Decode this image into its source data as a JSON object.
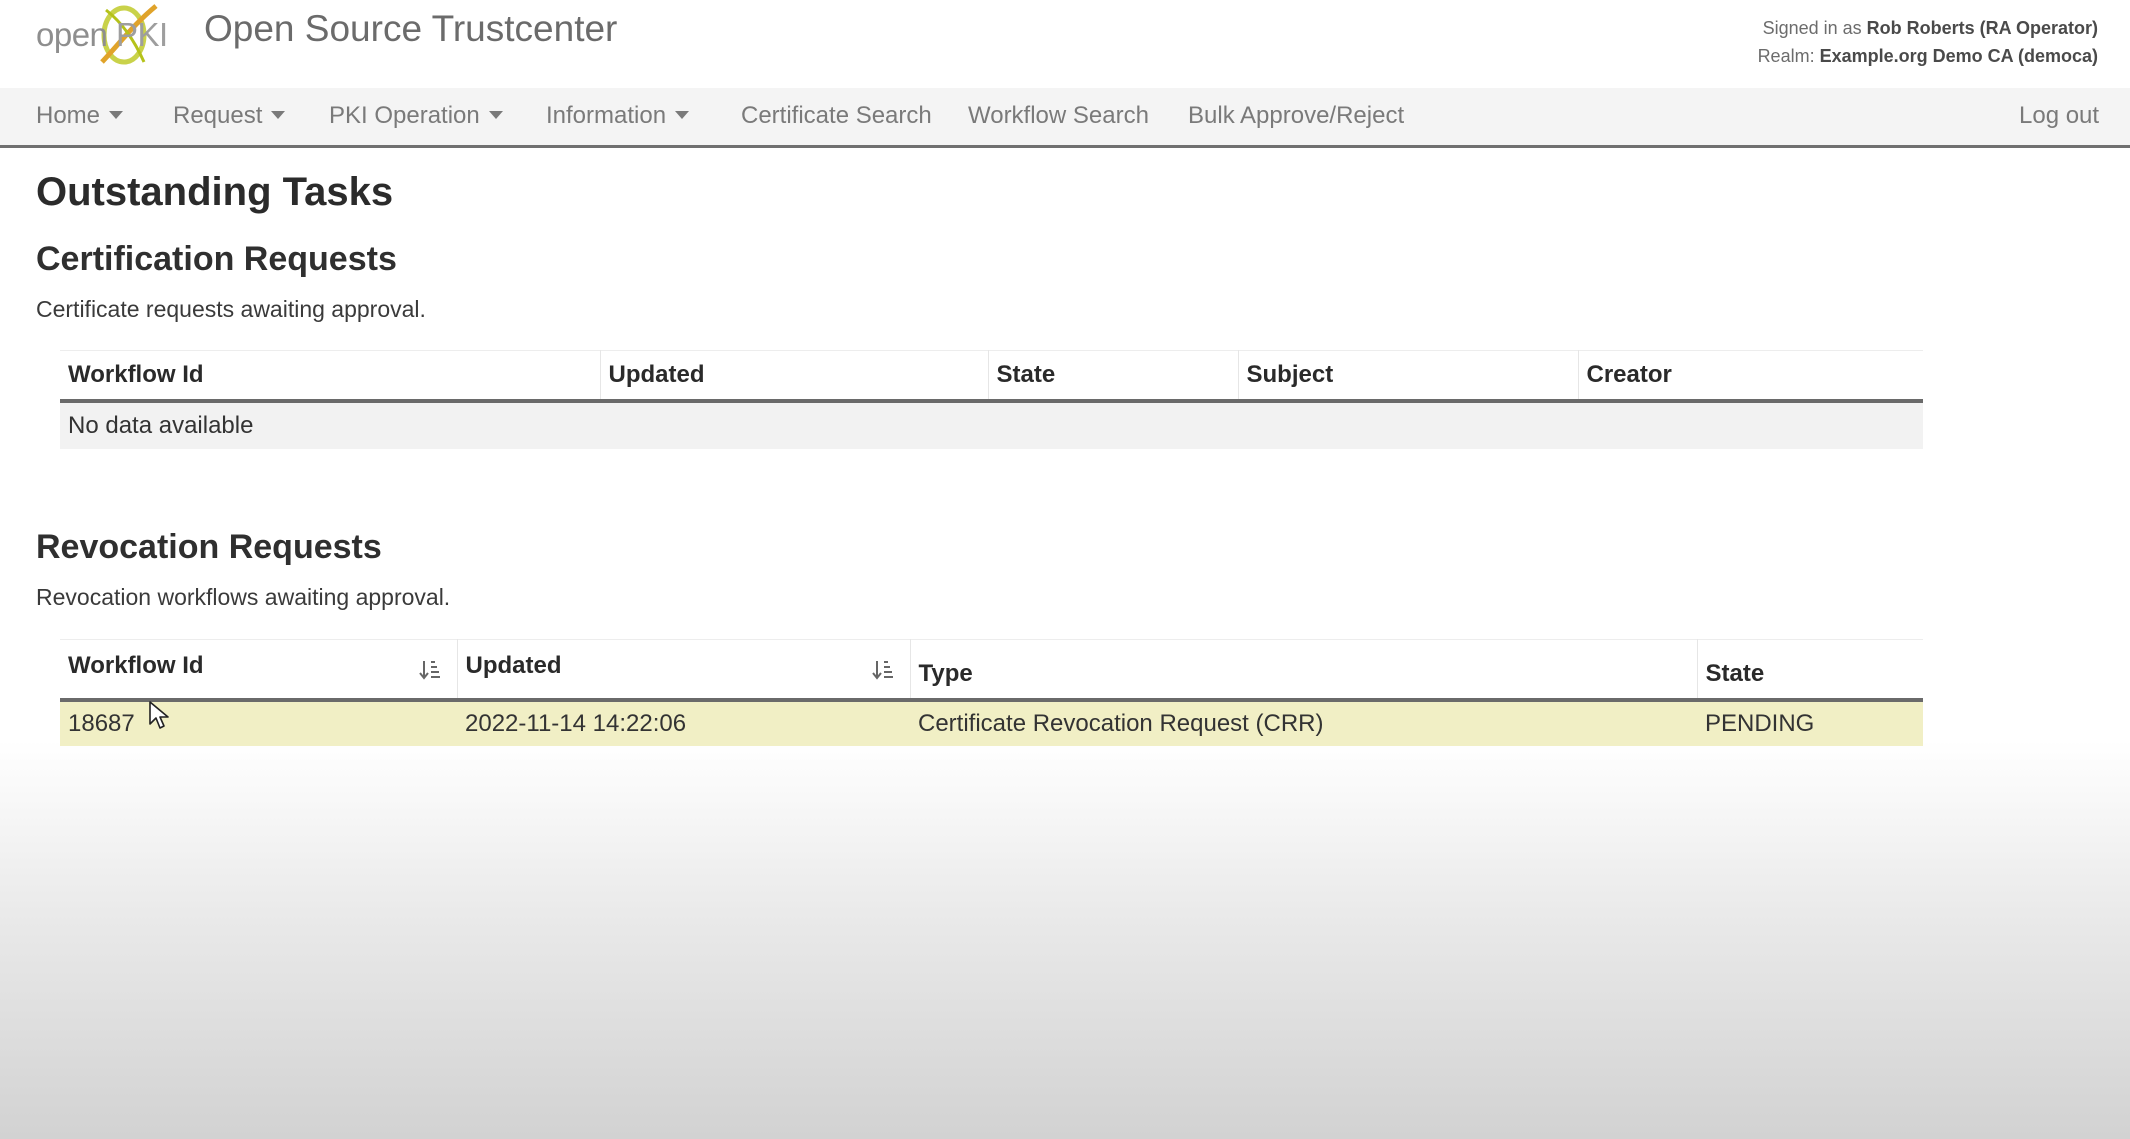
{
  "app": {
    "logo_text_open": "open",
    "logo_text_pki": "PKI",
    "title": "Open Source Trustcenter"
  },
  "user": {
    "signed_in_prefix": "Signed in as",
    "name": "Rob Roberts (RA Operator)",
    "realm_prefix": "Realm:",
    "realm": "Example.org Demo CA (democa)"
  },
  "nav": {
    "home": "Home",
    "request": "Request",
    "pki_operation": "PKI Operation",
    "information": "Information",
    "certificate_search": "Certificate Search",
    "workflow_search": "Workflow Search",
    "bulk": "Bulk Approve/Reject",
    "logout": "Log out"
  },
  "page_title": "Outstanding Tasks",
  "certification": {
    "heading": "Certification Requests",
    "description": "Certificate requests awaiting approval.",
    "columns": [
      "Workflow Id",
      "Updated",
      "State",
      "Subject",
      "Creator"
    ],
    "empty_text": "No data available"
  },
  "revocation": {
    "heading": "Revocation Requests",
    "description": "Revocation workflows awaiting approval.",
    "columns": [
      "Workflow Id",
      "Updated",
      "Type",
      "State"
    ],
    "rows": [
      [
        "18687",
        "2022-11-14 14:22:06",
        "Certificate Revocation Request (CRR)",
        "PENDING"
      ]
    ]
  },
  "colors": {
    "logo_accent": "#b5c21a",
    "highlight_row": "#f1efc5",
    "navbar_bg": "#f4f4f4"
  },
  "icons": {
    "sort": "sort-ascending-icon",
    "caret": "caret-down-icon",
    "cursor": "mouse-pointer-icon"
  }
}
